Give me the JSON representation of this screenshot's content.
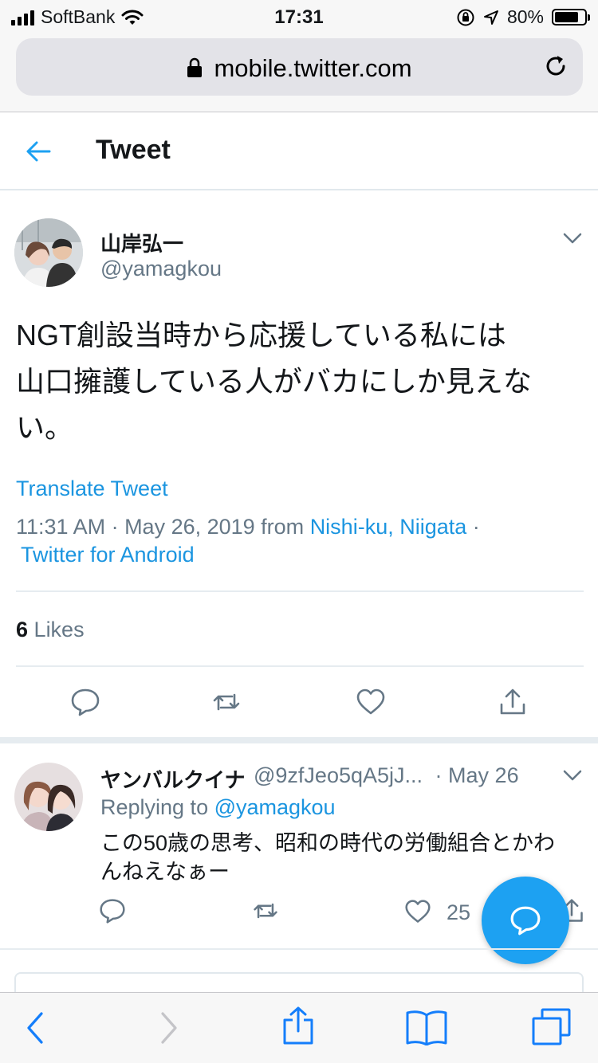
{
  "status_bar": {
    "carrier": "SoftBank",
    "time": "17:31",
    "battery": "80%",
    "battery_level": 0.8
  },
  "browser": {
    "url": "mobile.twitter.com"
  },
  "header": {
    "title": "Tweet"
  },
  "tweet": {
    "author_name": "山岸弘一",
    "author_handle": "@yamagkou",
    "text_lines": [
      "NGT創設当時から応援している私には",
      "山口擁護している人がバカにしか見えな",
      "い。"
    ],
    "translate_label": "Translate Tweet",
    "time_date": "11:31 AM · May 26, 2019 from ",
    "location": "Nishi-ku, Niigata",
    "separator": " ·",
    "source": "Twitter for Android",
    "likes_count": "6",
    "likes_label": "Likes"
  },
  "reply": {
    "author_name": "ヤンバルクイナ",
    "author_handle": "@9zfJeo5qA5jJ...",
    "date": "· May 26",
    "replying_label": "Replying to ",
    "replying_to": "@yamagkou",
    "text": "この50歳の思考、昭和の時代の労働組合とかわんねえなぁー",
    "like_count": "25"
  },
  "colors": {
    "accent": "#1da1f2",
    "link": "#1b95e0",
    "secondary_text": "#657786",
    "safari_blue": "#147efb"
  }
}
